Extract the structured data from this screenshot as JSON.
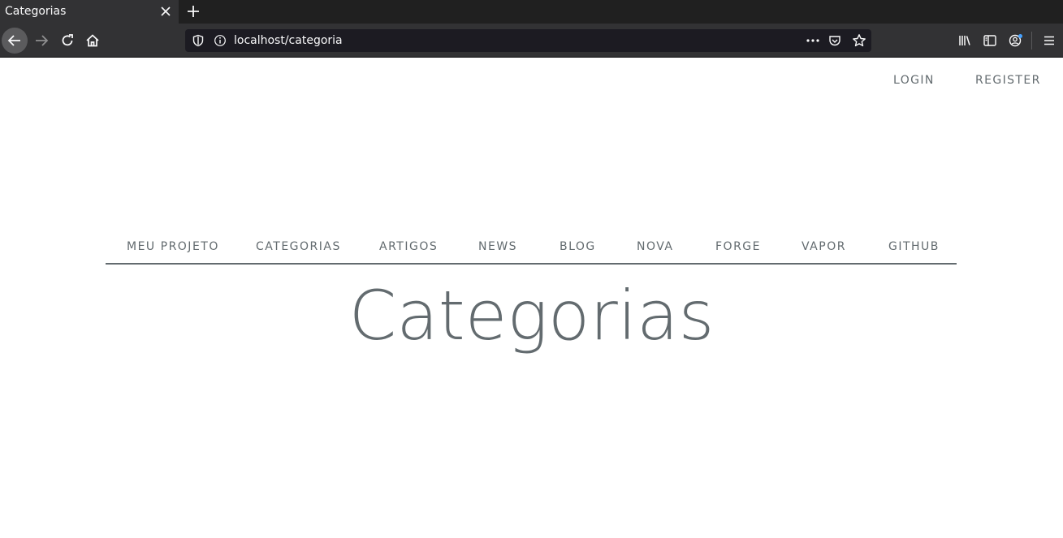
{
  "browser": {
    "tab_title": "Categorias",
    "url": "localhost/categoria"
  },
  "auth": {
    "login": "LOGIN",
    "register": "REGISTER"
  },
  "nav": {
    "items": [
      {
        "label": "MEU PROJETO"
      },
      {
        "label": "CATEGORIAS"
      },
      {
        "label": "ARTIGOS"
      },
      {
        "label": "NEWS"
      },
      {
        "label": "BLOG"
      },
      {
        "label": "NOVA"
      },
      {
        "label": "FORGE"
      },
      {
        "label": "VAPOR"
      },
      {
        "label": "GITHUB"
      }
    ]
  },
  "page": {
    "title": "Categorias"
  },
  "colors": {
    "text": "#636b6f",
    "chrome_dark": "#202020",
    "chrome_toolbar": "#323234",
    "urlbar": "#1c1b22"
  }
}
